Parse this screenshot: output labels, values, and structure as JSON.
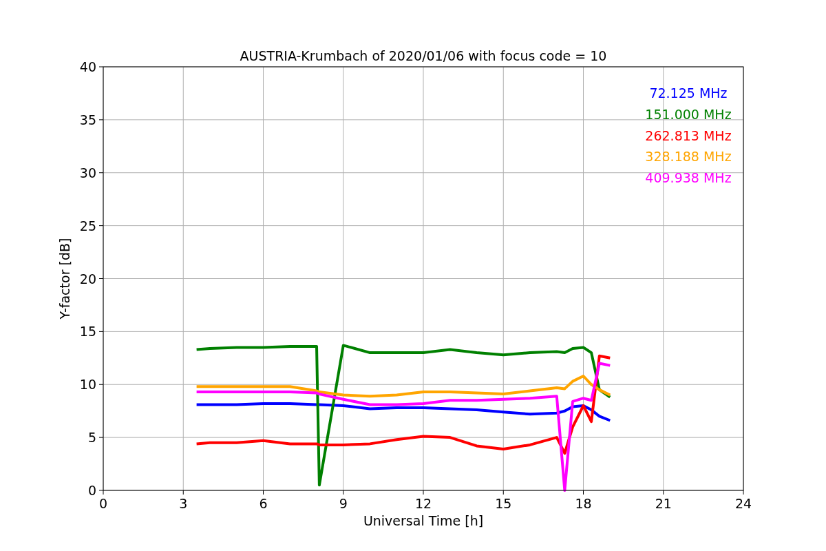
{
  "figure": {
    "chart_data": {
      "type": "line",
      "title": "AUSTRIA-Krumbach of 2020/01/06 with focus code = 10",
      "xlabel": "Universal Time [h]",
      "ylabel": "Y-factor [dB]",
      "x": [
        3.5,
        4,
        5,
        6,
        7,
        8,
        8.1,
        9,
        10,
        11,
        12,
        13,
        14,
        15,
        16,
        17,
        17.3,
        17.6,
        18,
        18.3,
        18.6,
        19
      ],
      "series": [
        {
          "name": "72.125 MHz",
          "color": "#0000ff",
          "values": [
            8.1,
            8.1,
            8.1,
            8.2,
            8.2,
            8.1,
            8.1,
            8.0,
            7.7,
            7.8,
            7.8,
            7.7,
            7.6,
            7.4,
            7.2,
            7.3,
            7.5,
            7.9,
            8.0,
            7.6,
            7.0,
            6.6
          ]
        },
        {
          "name": "151.000 MHz",
          "color": "#008000",
          "values": [
            13.3,
            13.4,
            13.5,
            13.5,
            13.6,
            13.6,
            0.5,
            13.7,
            13.0,
            13.0,
            13.0,
            13.3,
            13.0,
            12.8,
            13.0,
            13.1,
            13.0,
            13.4,
            13.5,
            13.0,
            9.5,
            8.8
          ]
        },
        {
          "name": "262.813 MHz",
          "color": "#ff0000",
          "values": [
            4.4,
            4.5,
            4.5,
            4.7,
            4.4,
            4.4,
            4.3,
            4.3,
            4.4,
            4.8,
            5.1,
            5.0,
            4.2,
            3.9,
            4.3,
            5.0,
            3.5,
            6.0,
            8.0,
            6.5,
            12.7,
            12.5
          ]
        },
        {
          "name": "328.188 MHz",
          "color": "#ffa500",
          "values": [
            9.8,
            9.8,
            9.8,
            9.8,
            9.8,
            9.4,
            9.3,
            9.0,
            8.9,
            9.0,
            9.3,
            9.3,
            9.2,
            9.1,
            9.4,
            9.7,
            9.6,
            10.3,
            10.8,
            10.0,
            9.5,
            9.0
          ]
        },
        {
          "name": "409.938 MHz",
          "color": "#ff00ff",
          "values": [
            9.3,
            9.3,
            9.3,
            9.3,
            9.3,
            9.2,
            9.1,
            8.6,
            8.1,
            8.1,
            8.2,
            8.5,
            8.5,
            8.6,
            8.7,
            8.9,
            0.0,
            8.4,
            8.7,
            8.5,
            12.0,
            11.8
          ]
        }
      ],
      "grid": true,
      "xlim": [
        0,
        24
      ],
      "ylim": [
        0,
        40
      ],
      "xticks": [
        0,
        3,
        6,
        9,
        12,
        15,
        18,
        21,
        24
      ],
      "yticks": [
        0,
        5,
        10,
        15,
        20,
        25,
        30,
        35,
        40
      ]
    }
  }
}
